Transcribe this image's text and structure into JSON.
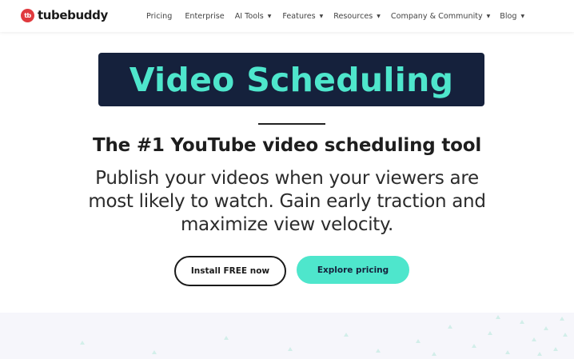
{
  "brand": {
    "logo_badge": "tb",
    "logo_text": "tubebuddy",
    "accent": "#4ee6cc",
    "navy": "#15213c",
    "logo_red": "#e03a3e"
  },
  "nav": {
    "items": [
      {
        "label": "Pricing",
        "dropdown": false
      },
      {
        "label": "Enterprise",
        "dropdown": false
      },
      {
        "label": "AI Tools",
        "dropdown": true
      },
      {
        "label": "Features",
        "dropdown": true
      },
      {
        "label": "Resources",
        "dropdown": true
      },
      {
        "label": "Company & Community",
        "dropdown": true
      },
      {
        "label": "Blog",
        "dropdown": true
      }
    ],
    "caret_glyph": "▼"
  },
  "hero": {
    "title": "Video Scheduling",
    "subtitle": "The #1 YouTube video scheduling tool",
    "description_lines": [
      "Publish your videos when your viewers are",
      "most likely to watch. Gain early traction and",
      "maximize view velocity."
    ],
    "primary_button": "Install FREE now",
    "secondary_button": "Explore pricing"
  }
}
